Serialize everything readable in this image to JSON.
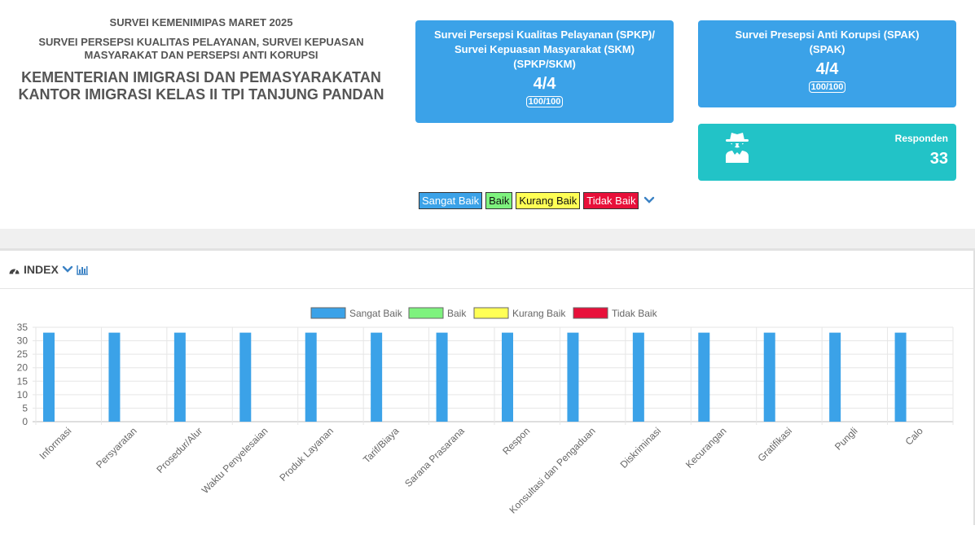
{
  "header": {
    "survey": "SURVEI KEMENIMIPAS MARET 2025",
    "subtitle": "SURVEI PERSEPSI KUALITAS PELAYANAN, SURVEI KEPUASAN MASYARAKAT DAN PERSEPSI ANTI KORUPSI",
    "ministry": "KEMENTERIAN IMIGRASI DAN PEMASYARAKATAN",
    "office": "KANTOR IMIGRASI KELAS II TPI TANJUNG PANDAN"
  },
  "cards": {
    "spkp": {
      "title_line1": "Survei Persepsi Kualitas Pelayanan (SPKP)/",
      "title_line2": "Survei Kepuasan Masyarakat (SKM)",
      "title_line3": "(SPKP/SKM)",
      "score": "4/4",
      "badge": "100/100"
    },
    "spak": {
      "title_line1": "Survei Presepsi Anti Korupsi (SPAK)",
      "title_line2": "(SPAK)",
      "score": "4/4",
      "badge": "100/100"
    },
    "responden": {
      "label": "Responden",
      "value": "33",
      "icon": "spy-icon"
    }
  },
  "legend_pills": [
    "Sangat Baik",
    "Baik",
    "Kurang Baik",
    "Tidak Baik"
  ],
  "index_section": {
    "title": "INDEX",
    "icons": [
      "dashboard-icon",
      "chevron-down-icon",
      "bar-chart-icon"
    ]
  },
  "colors": {
    "sangat_baik": "#3ba2e8",
    "baik": "#7ef27e",
    "kurang_baik": "#ffff55",
    "tidak_baik": "#e8103a",
    "card_blue": "#3ba2e8",
    "card_teal": "#22c3c7"
  },
  "chart_data": {
    "type": "bar",
    "categories": [
      "Informasi",
      "Persyaratan",
      "Prosedur/Alur",
      "Waktu Penyelesaian",
      "Produk Layanan",
      "Tarif/Biaya",
      "Sarana Prasarana",
      "Respon",
      "Konsultasi dan Pengaduan",
      "Diskriminasi",
      "Kecurangan",
      "Gratifikasi",
      "Pungli",
      "Calo"
    ],
    "series": [
      {
        "name": "Sangat Baik",
        "color": "#3ba2e8",
        "values": [
          33,
          33,
          33,
          33,
          33,
          33,
          33,
          33,
          33,
          33,
          33,
          33,
          33,
          33
        ]
      },
      {
        "name": "Baik",
        "color": "#7ef27e",
        "values": [
          0,
          0,
          0,
          0,
          0,
          0,
          0,
          0,
          0,
          0,
          0,
          0,
          0,
          0
        ]
      },
      {
        "name": "Kurang Baik",
        "color": "#ffff55",
        "values": [
          0,
          0,
          0,
          0,
          0,
          0,
          0,
          0,
          0,
          0,
          0,
          0,
          0,
          0
        ]
      },
      {
        "name": "Tidak Baik",
        "color": "#e8103a",
        "values": [
          0,
          0,
          0,
          0,
          0,
          0,
          0,
          0,
          0,
          0,
          0,
          0,
          0,
          0
        ]
      }
    ],
    "yticks": [
      0,
      5,
      10,
      15,
      20,
      25,
      30,
      35
    ],
    "ylim": [
      0,
      35
    ],
    "grid": true,
    "legend_position": "top-center"
  }
}
